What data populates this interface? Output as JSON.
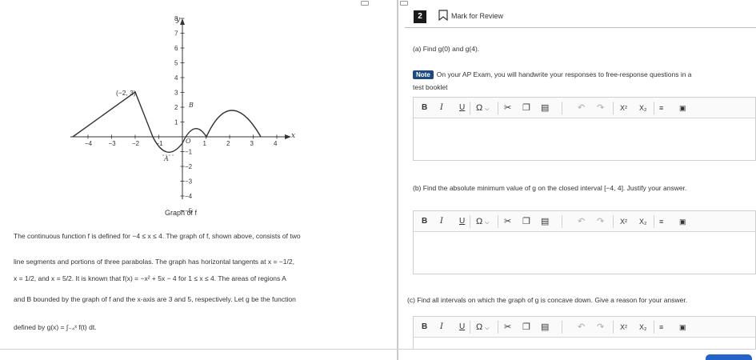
{
  "header": {
    "question_number": "2",
    "mark_for_review": "Mark for Review"
  },
  "graph": {
    "caption": "Graph of f",
    "x_axis_label": "x",
    "y_axis_label": "y",
    "x_ticks": [
      "−4",
      "−3",
      "−2",
      "−1",
      "1",
      "2",
      "3",
      "4"
    ],
    "y_ticks_pos": [
      "8",
      "7",
      "6",
      "5",
      "4",
      "3",
      "2",
      "1"
    ],
    "y_ticks_neg": [
      "−1",
      "−2",
      "−3",
      "−4",
      "−5"
    ],
    "origin_label": "O",
    "point_label": "(−2, 3)",
    "region_a": "A",
    "region_b": "B"
  },
  "stimulus": {
    "line1": "The continuous function f is defined for −4 ≤ x ≤ 4. The graph of f, shown above, consists of two",
    "line2": "line segments and portions of three parabolas. The graph has horizontal tangents at x = −1/2,",
    "line3": "x = 1/2, and x = 5/2. It is known that f(x) = −x² + 5x − 4 for 1 ≤ x ≤ 4. The areas of regions A",
    "line4": "and B bounded by the graph of f and the x-axis are 3 and 5, respectively. Let g be the function",
    "line5": "defined by g(x) = ∫₋₄ˣ f(t) dt."
  },
  "parts": {
    "a": "(a) Find g(0) and g(4).",
    "note_badge": "Note",
    "note_text_1": "On your AP Exam, you will handwrite your responses to free-response questions in a",
    "note_text_2": "test booklet",
    "b": "(b) Find the absolute minimum value of g on the closed interval [−4, 4]. Justify your answer.",
    "c": "(c) Find all intervals on which the graph of g is concave down. Give a reason for your answer."
  },
  "toolbar": {
    "bold": "B",
    "italic": "I",
    "underline": "U",
    "omega": "Ω",
    "superscript": "X²",
    "subscript": "X₂"
  }
}
